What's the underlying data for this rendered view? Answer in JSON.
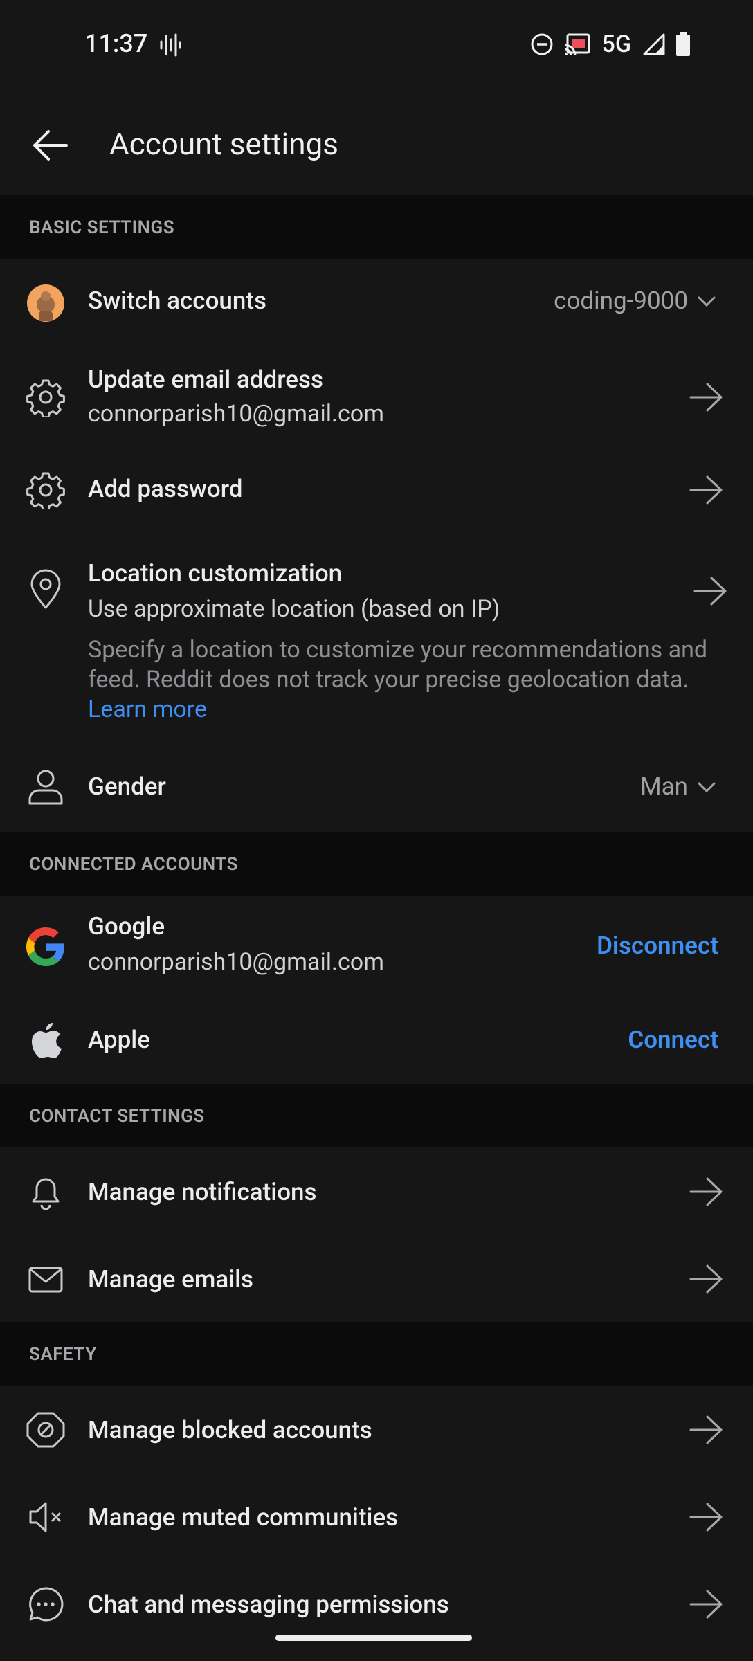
{
  "status_bar": {
    "time": "11:37",
    "network": "5G"
  },
  "header": {
    "title": "Account settings"
  },
  "sections": {
    "basic": "BASIC SETTINGS",
    "connected": "CONNECTED ACCOUNTS",
    "contact": "CONTACT SETTINGS",
    "safety": "SAFETY"
  },
  "basic": {
    "switch_accounts": {
      "label": "Switch accounts",
      "value": "coding-9000"
    },
    "update_email": {
      "label": "Update email address",
      "value": "connorparish10@gmail.com"
    },
    "add_password": {
      "label": "Add password"
    },
    "location": {
      "label": "Location customization",
      "value": "Use approximate location (based on IP)",
      "description": "Specify a location to customize your recommendations and feed. Reddit does not track your precise geolocation data.",
      "link": "Learn more"
    },
    "gender": {
      "label": "Gender",
      "value": "Man"
    }
  },
  "connected": {
    "google": {
      "label": "Google",
      "email": "connorparish10@gmail.com",
      "action": "Disconnect"
    },
    "apple": {
      "label": "Apple",
      "action": "Connect"
    }
  },
  "contact": {
    "notifications": {
      "label": "Manage notifications"
    },
    "emails": {
      "label": "Manage emails"
    }
  },
  "safety": {
    "blocked": {
      "label": "Manage blocked accounts"
    },
    "muted": {
      "label": "Manage muted communities"
    },
    "chat": {
      "label": "Chat and messaging permissions"
    }
  },
  "colors": {
    "background": "#161617",
    "section_bg": "#0b0b0c",
    "accent": "#3d8ff0"
  }
}
